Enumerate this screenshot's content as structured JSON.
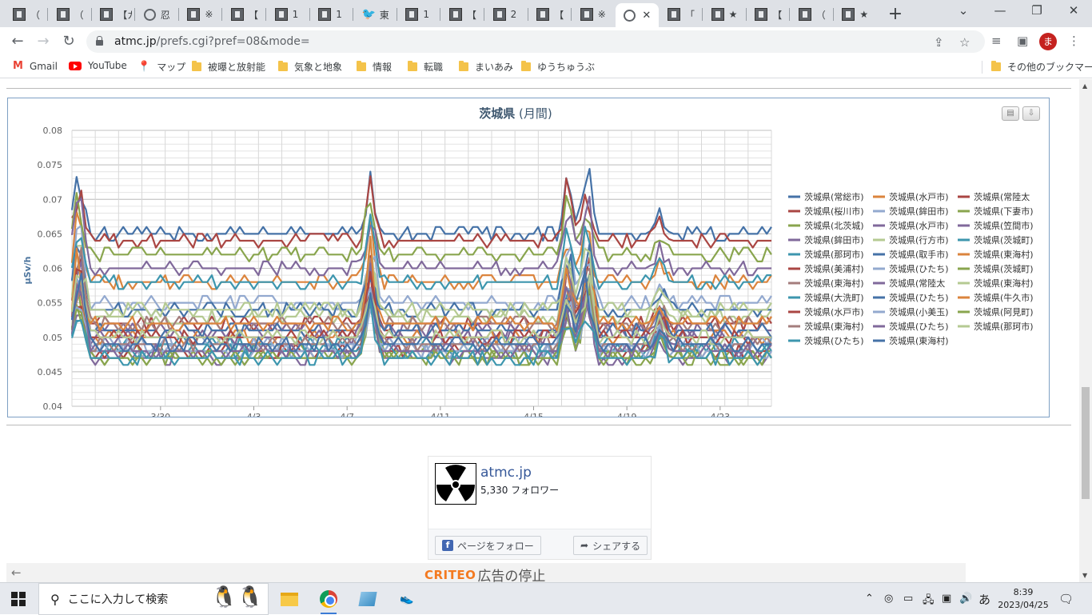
{
  "browser": {
    "tabs": [
      {
        "title": "（",
        "icon": "site-favicon"
      },
      {
        "title": "（",
        "icon": "site-favicon"
      },
      {
        "title": "【ガ",
        "icon": "site-favicon"
      },
      {
        "title": "忍",
        "icon": "globe-icon"
      },
      {
        "title": "※",
        "icon": "site-favicon"
      },
      {
        "title": "【",
        "icon": "site-favicon"
      },
      {
        "title": "1",
        "icon": "site-favicon"
      },
      {
        "title": "1",
        "icon": "site-favicon"
      },
      {
        "title": "東",
        "icon": "twitter-icon"
      },
      {
        "title": "1",
        "icon": "site-favicon"
      },
      {
        "title": "【",
        "icon": "site-favicon"
      },
      {
        "title": "2",
        "icon": "site-favicon"
      },
      {
        "title": "【",
        "icon": "site-favicon"
      },
      {
        "title": "※",
        "icon": "site-favicon"
      },
      {
        "title": "",
        "icon": "globe-icon",
        "active": true
      },
      {
        "title": "「",
        "icon": "site-favicon"
      },
      {
        "title": "★",
        "icon": "site-favicon"
      },
      {
        "title": "【",
        "icon": "site-favicon"
      },
      {
        "title": "（",
        "icon": "site-favicon"
      },
      {
        "title": "★",
        "icon": "site-favicon"
      }
    ],
    "url_host": "atmc.jp",
    "url_path": "/prefs.cgi?pref=08&mode=",
    "avatar_letter": "ま",
    "bookmarks": [
      {
        "label": "Gmail",
        "icon": "gmail-icon"
      },
      {
        "label": "YouTube",
        "icon": "youtube-icon"
      },
      {
        "label": "マップ",
        "icon": "maps-icon"
      },
      {
        "label": "被曝と放射能",
        "icon": "folder-icon"
      },
      {
        "label": "気象と地象",
        "icon": "folder-icon"
      },
      {
        "label": "情報",
        "icon": "folder-icon"
      },
      {
        "label": "転職",
        "icon": "folder-icon"
      },
      {
        "label": "まいあみ",
        "icon": "folder-icon"
      },
      {
        "label": "ゆうちゅうぶ",
        "icon": "folder-icon"
      }
    ],
    "other_bookmarks": "その他のブックマーク"
  },
  "chart_data": {
    "type": "line",
    "title": "茨城県",
    "subtitle": "(月間)",
    "ylabel": "µSv/h",
    "ylim": [
      0.04,
      0.08
    ],
    "yticks": [
      "0.08",
      "0.075",
      "0.07",
      "0.065",
      "0.06",
      "0.055",
      "0.05",
      "0.045",
      "0.04"
    ],
    "xticks": [
      "3/30",
      "4/3",
      "4/7",
      "4/11",
      "4/15",
      "4/19",
      "4/23"
    ],
    "grid": true,
    "legend_position": "right",
    "series": [
      {
        "name": "茨城県(常総市)",
        "color": "#4572a7",
        "base": 0.065
      },
      {
        "name": "茨城県(水戸市)",
        "color": "#db843d",
        "base": 0.058
      },
      {
        "name": "茨城県(常陸太",
        "color": "#aa4643",
        "base": 0.064
      },
      {
        "name": "茨城県(桜川市)",
        "color": "#aa4643",
        "base": 0.052
      },
      {
        "name": "茨城県(鉾田市)",
        "color": "#93a9cf",
        "base": 0.055
      },
      {
        "name": "茨城県(下妻市)",
        "color": "#89a54e",
        "base": 0.062
      },
      {
        "name": "茨城県(北茨城)",
        "color": "#89a54e",
        "base": 0.048
      },
      {
        "name": "茨城県(水戸市)",
        "color": "#80699b",
        "base": 0.051
      },
      {
        "name": "茨城県(笠間市)",
        "color": "#80699b",
        "base": 0.06
      },
      {
        "name": "茨城県(鉾田市)",
        "color": "#80699b",
        "base": 0.047
      },
      {
        "name": "茨城県(行方市)",
        "color": "#b5ca92",
        "base": 0.053
      },
      {
        "name": "茨城県(茨城町)",
        "color": "#3d96ae",
        "base": 0.058
      },
      {
        "name": "茨城県(那珂市)",
        "color": "#3d96ae",
        "base": 0.049
      },
      {
        "name": "茨城県(取手市)",
        "color": "#4572a7",
        "base": 0.054
      },
      {
        "name": "茨城県(東海村)",
        "color": "#db843d",
        "base": 0.05
      },
      {
        "name": "茨城県(美浦村)",
        "color": "#aa4643",
        "base": 0.048
      },
      {
        "name": "茨城県(ひたち)",
        "color": "#93a9cf",
        "base": 0.049
      },
      {
        "name": "茨城県(茨城町)",
        "color": "#89a54e",
        "base": 0.047
      },
      {
        "name": "茨城県(東海村)",
        "color": "#a47d7c",
        "base": 0.052
      },
      {
        "name": "茨城県(常陸太",
        "color": "#80699b",
        "base": 0.05
      },
      {
        "name": "茨城県(東海村)",
        "color": "#b5ca92",
        "base": 0.054
      },
      {
        "name": "茨城県(大洗町)",
        "color": "#3d96ae",
        "base": 0.048
      },
      {
        "name": "茨城県(ひたち)",
        "color": "#4572a7",
        "base": 0.051
      },
      {
        "name": "茨城県(牛久市)",
        "color": "#db843d",
        "base": 0.052
      },
      {
        "name": "茨城県(水戸市)",
        "color": "#aa4643",
        "base": 0.05
      },
      {
        "name": "茨城県(小美玉)",
        "color": "#93a9cf",
        "base": 0.048
      },
      {
        "name": "茨城県(阿見町)",
        "color": "#89a54e",
        "base": 0.047
      },
      {
        "name": "茨城県(東海村)",
        "color": "#a47d7c",
        "base": 0.049
      },
      {
        "name": "茨城県(ひたち)",
        "color": "#80699b",
        "base": 0.048
      },
      {
        "name": "茨城県(那珂市)",
        "color": "#b5ca92",
        "base": 0.05
      },
      {
        "name": "茨城県(ひたち)",
        "color": "#3d96ae",
        "base": 0.047
      },
      {
        "name": "茨城県(東海村)",
        "color": "#4572a7",
        "base": 0.049
      }
    ],
    "spikes": [
      {
        "day": 0.3,
        "amp": 0.014
      },
      {
        "day": 12.8,
        "amp": 0.012
      },
      {
        "day": 21.3,
        "amp": 0.011
      },
      {
        "day": 22.1,
        "amp": 0.013
      },
      {
        "day": 25.2,
        "amp": 0.004
      }
    ]
  },
  "facebook": {
    "page_name": "atmc.jp",
    "followers": "5,330 フォロワー",
    "follow_label": "ページをフォロー",
    "share_label": "シェアする"
  },
  "ad": {
    "brand": "CRITEO",
    "stop_label": "広告の停止"
  },
  "taskbar": {
    "search_placeholder": "ここに入力して検索",
    "time": "8:39",
    "date": "2023/04/25",
    "ime": "あ"
  }
}
